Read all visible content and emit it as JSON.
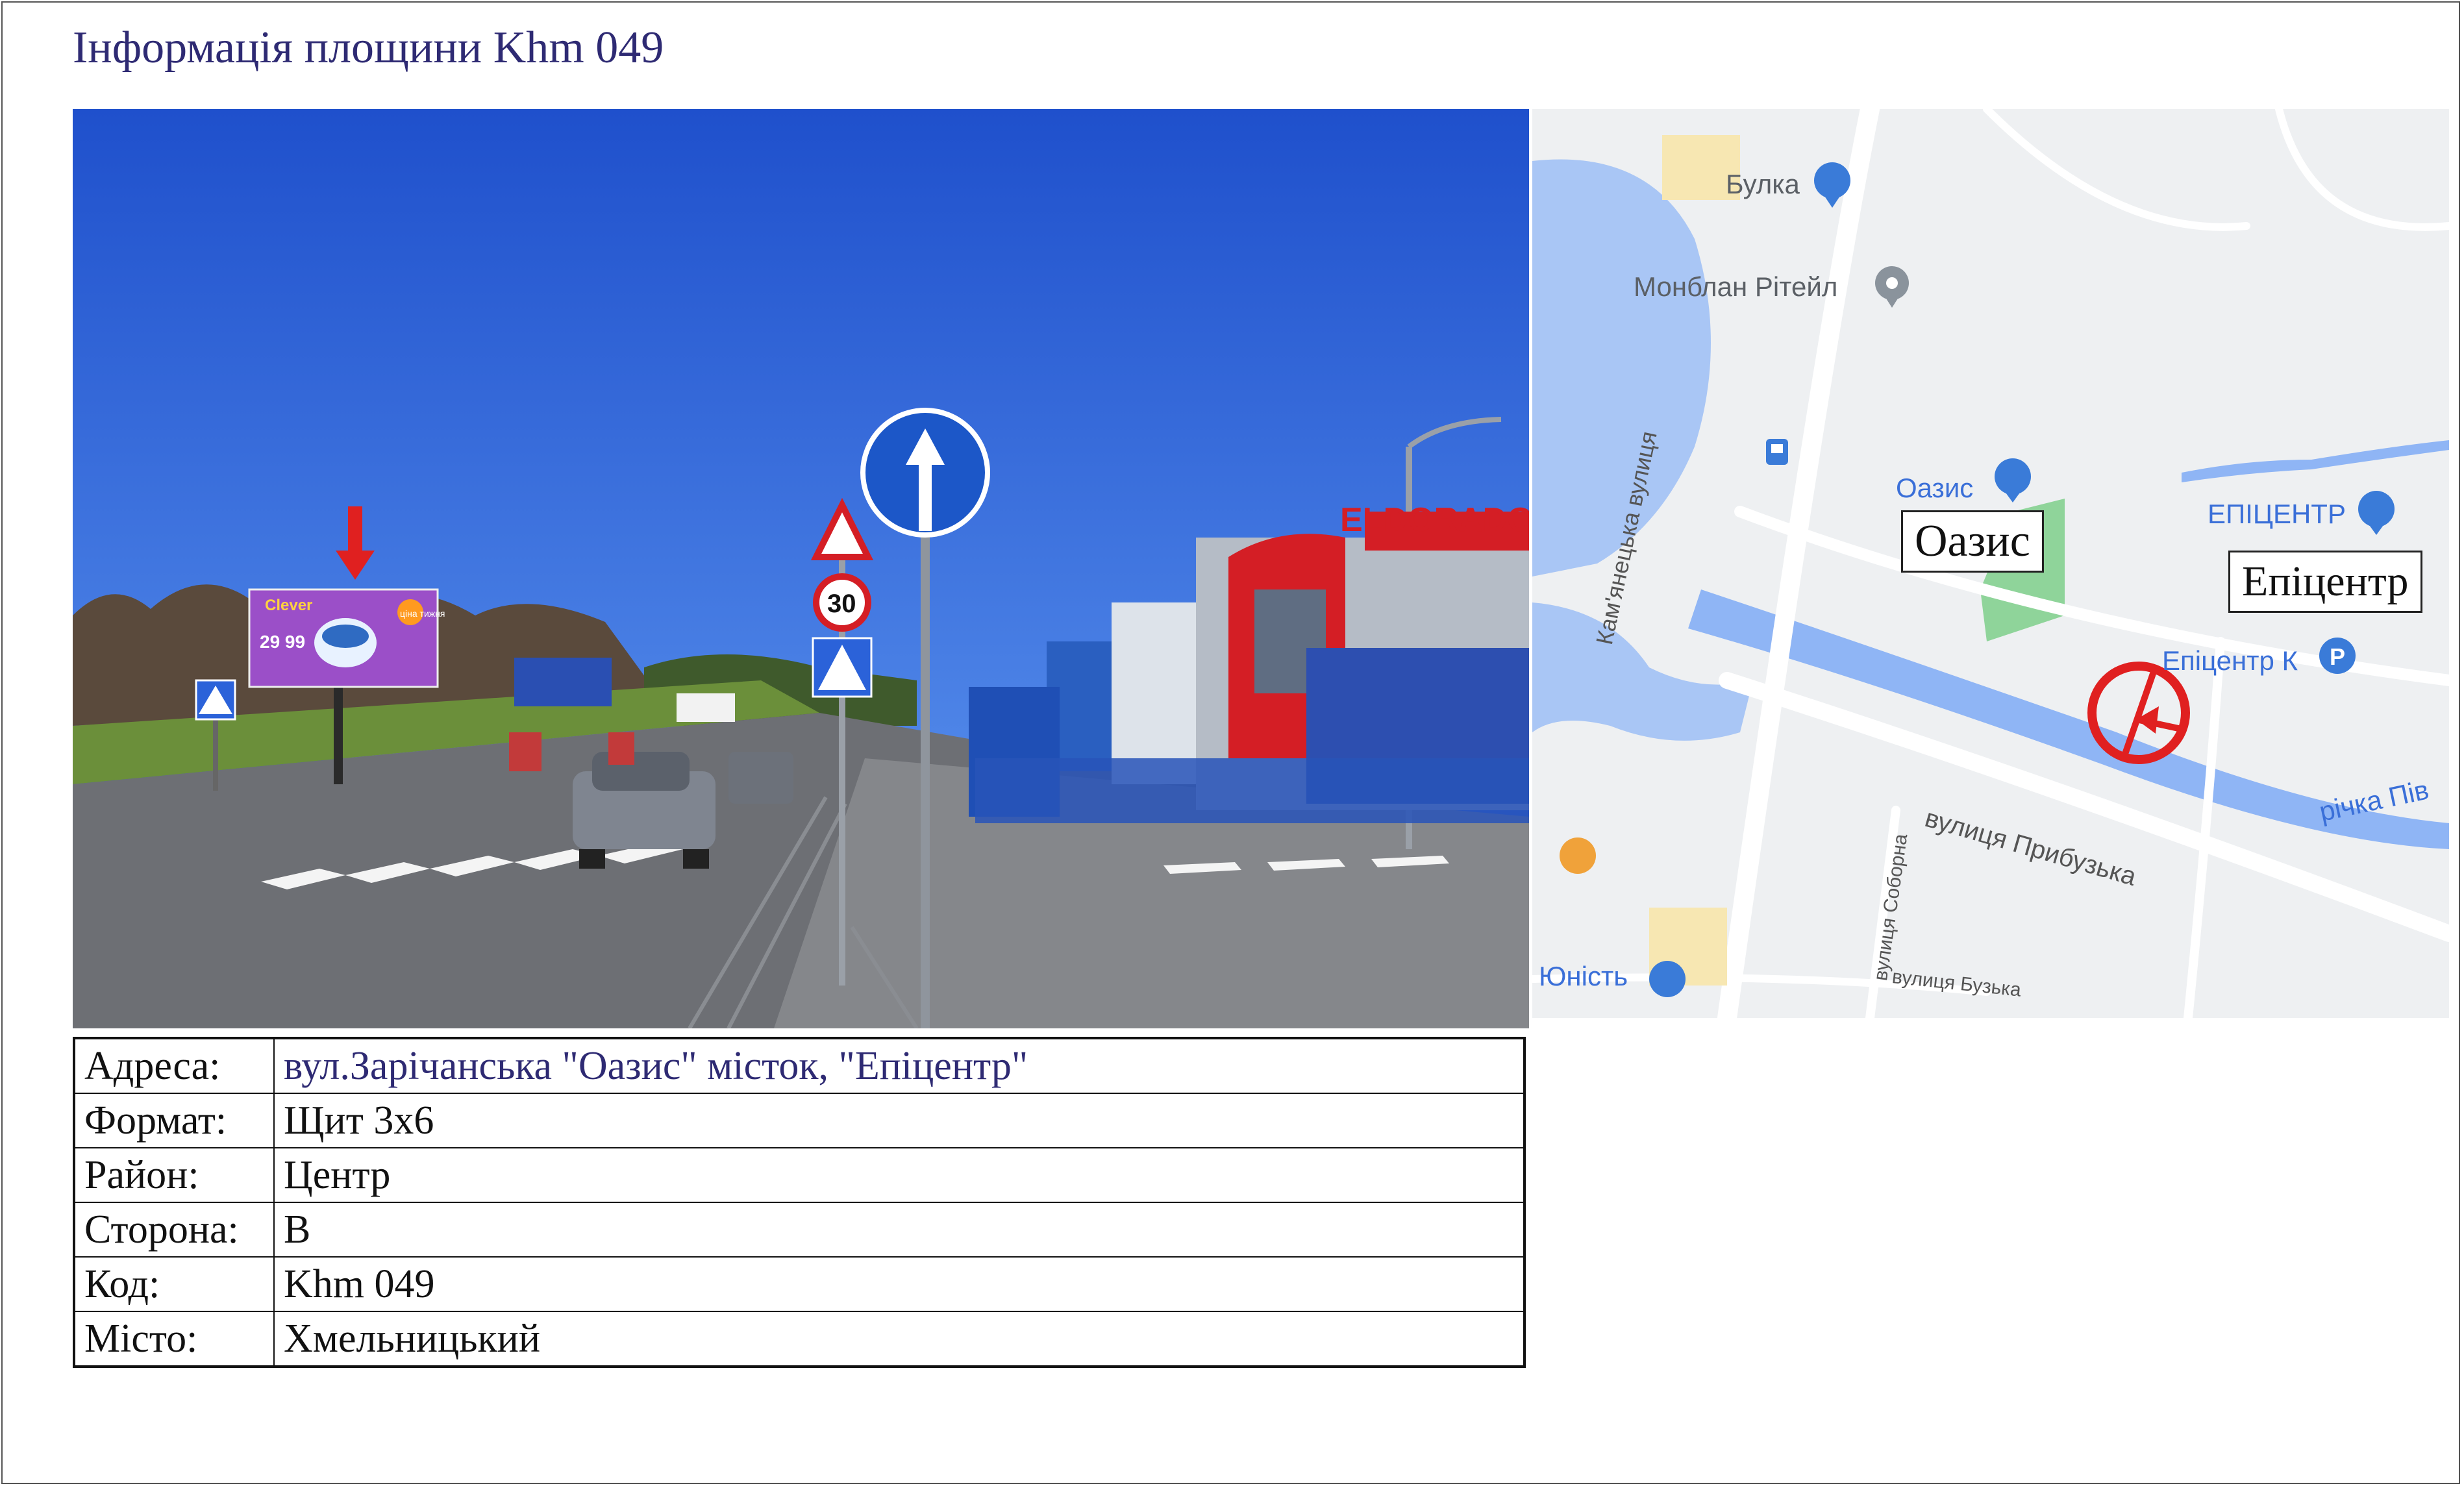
{
  "page": {
    "title": "Інформація площини Khm 049"
  },
  "photo": {
    "board": {
      "brand": "Clever",
      "price": "29 99",
      "tag": "ціна тижня"
    },
    "signs": {
      "speed_limit": "30",
      "store": "ELDORADO"
    },
    "colors": {
      "sky": "#2b62d9",
      "board": "#9b4fc8",
      "arrow": "#e02020",
      "eldorado": "#d41e25"
    }
  },
  "map": {
    "pois": {
      "bulka": "Булка",
      "monblan": "Монблан Рітейл",
      "oazys_poi": "Оазис",
      "epitsentr_poi": "ЕПІЦЕНТР",
      "epitsentr_k": "Епіцентр К",
      "yunist": "Юність"
    },
    "streets": {
      "kamianetska": "Кам'янецька вулиця",
      "prybuzka": "вулиця Прибузька",
      "soborna": "вулиця Соборна",
      "buzka": "вулиця Бузька",
      "river": "річка Пів"
    },
    "callouts": {
      "oazys": "Оазис",
      "epitsentr": "Епіцентр"
    },
    "icons": {
      "shop": "shopping-bag-icon",
      "pin": "map-pin-icon",
      "parking": "parking-icon",
      "bus": "bus-stop-icon",
      "marker": "billboard-direction-marker-icon"
    }
  },
  "info": {
    "rows": [
      {
        "label": "Адреса:",
        "value": "вул.Зарічанська \"Оазис\" місток, \"Епіцентр\""
      },
      {
        "label": "Формат:",
        "value": "Щит 3х6"
      },
      {
        "label": "Район:",
        "value": "Центр"
      },
      {
        "label": "Сторона:",
        "value": "В"
      },
      {
        "label": "Код:",
        "value": "Khm 049"
      },
      {
        "label": "Місто:",
        "value": "Хмельницький"
      }
    ]
  }
}
